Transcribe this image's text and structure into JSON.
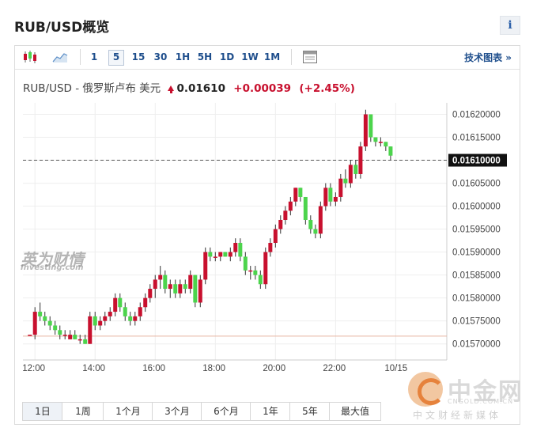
{
  "page": {
    "title": "RUB/USD概览",
    "info_label": "i"
  },
  "toolbar": {
    "intervals": [
      "1",
      "5",
      "15",
      "30",
      "1H",
      "5H",
      "1D",
      "1W",
      "1M"
    ],
    "active_interval": "5",
    "tech_link": "技术图表 »"
  },
  "quote": {
    "pair": "RUB/USD - 俄罗斯卢布 美元",
    "price": "0.01610",
    "change": "+0.00039",
    "change_pct": "(+2.45%)"
  },
  "watermark": {
    "main": "英为财情",
    "sub": "Investing.com"
  },
  "ranges": {
    "items": [
      "1日",
      "1周",
      "1个月",
      "3个月",
      "6个月",
      "1年",
      "5年",
      "最大值"
    ],
    "active": "1日"
  },
  "colors": {
    "up": "#c8102e",
    "down": "#4cd44c",
    "last_line": "#555555",
    "ref_line": "#e8b4a0",
    "grid": "#eeeeee"
  },
  "brand": {
    "name": "中金网",
    "url": "CNGOLD.COM.CN",
    "slogan": "中文财经新媒体"
  },
  "chart_data": {
    "type": "candlestick",
    "x_labels": [
      "12:00",
      "14:00",
      "16:00",
      "18:00",
      "20:00",
      "22:00",
      "10/15"
    ],
    "y_ticks": [
      "0.01570000",
      "0.01575000",
      "0.01580000",
      "0.01585000",
      "0.01590000",
      "0.01595000",
      "0.01600000",
      "0.01605000",
      "0.01610000",
      "0.01615000",
      "0.01620000"
    ],
    "ylim": [
      0.015665,
      0.016225
    ],
    "xlim": [
      11.6,
      25.7
    ],
    "last_price": 0.0161,
    "last_label": "0.01610000",
    "ref_price": 0.015717,
    "grid": true,
    "candles": [
      {
        "t": 11.83,
        "o": 0.01572,
        "h": 0.01572,
        "l": 0.01572,
        "c": 0.01572
      },
      {
        "t": 12.0,
        "o": 0.01572,
        "h": 0.01578,
        "l": 0.01571,
        "c": 0.01577
      },
      {
        "t": 12.17,
        "o": 0.01577,
        "h": 0.01579,
        "l": 0.01575,
        "c": 0.01576
      },
      {
        "t": 12.33,
        "o": 0.01576,
        "h": 0.01577,
        "l": 0.01574,
        "c": 0.01575
      },
      {
        "t": 12.5,
        "o": 0.01575,
        "h": 0.01576,
        "l": 0.01573,
        "c": 0.01574
      },
      {
        "t": 12.67,
        "o": 0.01574,
        "h": 0.01575,
        "l": 0.01572,
        "c": 0.01573
      },
      {
        "t": 12.83,
        "o": 0.01573,
        "h": 0.01574,
        "l": 0.01571,
        "c": 0.01572
      },
      {
        "t": 13.0,
        "o": 0.01572,
        "h": 0.01573,
        "l": 0.01571,
        "c": 0.01572
      },
      {
        "t": 13.17,
        "o": 0.01571,
        "h": 0.01573,
        "l": 0.01571,
        "c": 0.01572
      },
      {
        "t": 13.33,
        "o": 0.01572,
        "h": 0.01573,
        "l": 0.01571,
        "c": 0.01571
      },
      {
        "t": 13.5,
        "o": 0.01571,
        "h": 0.01572,
        "l": 0.0157,
        "c": 0.01571
      },
      {
        "t": 13.67,
        "o": 0.01571,
        "h": 0.01572,
        "l": 0.0157,
        "c": 0.0157
      },
      {
        "t": 13.83,
        "o": 0.0157,
        "h": 0.01577,
        "l": 0.0157,
        "c": 0.01576
      },
      {
        "t": 14.0,
        "o": 0.01576,
        "h": 0.01577,
        "l": 0.01573,
        "c": 0.01574
      },
      {
        "t": 14.17,
        "o": 0.01574,
        "h": 0.01576,
        "l": 0.01573,
        "c": 0.01575
      },
      {
        "t": 14.33,
        "o": 0.01575,
        "h": 0.01577,
        "l": 0.01574,
        "c": 0.01576
      },
      {
        "t": 14.5,
        "o": 0.01576,
        "h": 0.01578,
        "l": 0.01575,
        "c": 0.01577
      },
      {
        "t": 14.67,
        "o": 0.01577,
        "h": 0.01581,
        "l": 0.01576,
        "c": 0.0158
      },
      {
        "t": 14.83,
        "o": 0.0158,
        "h": 0.01581,
        "l": 0.01577,
        "c": 0.01578
      },
      {
        "t": 15.0,
        "o": 0.01578,
        "h": 0.01579,
        "l": 0.01575,
        "c": 0.01576
      },
      {
        "t": 15.17,
        "o": 0.01576,
        "h": 0.01577,
        "l": 0.01574,
        "c": 0.01575
      },
      {
        "t": 15.33,
        "o": 0.01575,
        "h": 0.01577,
        "l": 0.01574,
        "c": 0.01576
      },
      {
        "t": 15.5,
        "o": 0.01576,
        "h": 0.01579,
        "l": 0.01575,
        "c": 0.01578
      },
      {
        "t": 15.67,
        "o": 0.01578,
        "h": 0.01581,
        "l": 0.01577,
        "c": 0.0158
      },
      {
        "t": 15.83,
        "o": 0.0158,
        "h": 0.01583,
        "l": 0.01579,
        "c": 0.01582
      },
      {
        "t": 16.0,
        "o": 0.01582,
        "h": 0.01585,
        "l": 0.0158,
        "c": 0.01584
      },
      {
        "t": 16.17,
        "o": 0.01584,
        "h": 0.01587,
        "l": 0.01582,
        "c": 0.01585
      },
      {
        "t": 16.33,
        "o": 0.01585,
        "h": 0.01586,
        "l": 0.01581,
        "c": 0.01582
      },
      {
        "t": 16.5,
        "o": 0.01582,
        "h": 0.01584,
        "l": 0.0158,
        "c": 0.01583
      },
      {
        "t": 16.67,
        "o": 0.01583,
        "h": 0.01584,
        "l": 0.0158,
        "c": 0.01581
      },
      {
        "t": 16.83,
        "o": 0.01581,
        "h": 0.01584,
        "l": 0.0158,
        "c": 0.01583
      },
      {
        "t": 17.0,
        "o": 0.01583,
        "h": 0.01584,
        "l": 0.01581,
        "c": 0.01582
      },
      {
        "t": 17.17,
        "o": 0.01582,
        "h": 0.01586,
        "l": 0.01581,
        "c": 0.01585
      },
      {
        "t": 17.33,
        "o": 0.01585,
        "h": 0.01585,
        "l": 0.01578,
        "c": 0.01579
      },
      {
        "t": 17.5,
        "o": 0.01579,
        "h": 0.01585,
        "l": 0.01578,
        "c": 0.01584
      },
      {
        "t": 17.67,
        "o": 0.01584,
        "h": 0.01591,
        "l": 0.01583,
        "c": 0.0159
      },
      {
        "t": 17.83,
        "o": 0.0159,
        "h": 0.01591,
        "l": 0.01588,
        "c": 0.01589
      },
      {
        "t": 18.0,
        "o": 0.01589,
        "h": 0.0159,
        "l": 0.01588,
        "c": 0.01589
      },
      {
        "t": 18.17,
        "o": 0.01589,
        "h": 0.0159,
        "l": 0.01588,
        "c": 0.0159
      },
      {
        "t": 18.33,
        "o": 0.0159,
        "h": 0.0159,
        "l": 0.01589,
        "c": 0.01589
      },
      {
        "t": 18.5,
        "o": 0.01589,
        "h": 0.01591,
        "l": 0.01588,
        "c": 0.0159
      },
      {
        "t": 18.67,
        "o": 0.0159,
        "h": 0.01593,
        "l": 0.01589,
        "c": 0.01592
      },
      {
        "t": 18.83,
        "o": 0.01592,
        "h": 0.01593,
        "l": 0.01588,
        "c": 0.01589
      },
      {
        "t": 19.0,
        "o": 0.01589,
        "h": 0.0159,
        "l": 0.01585,
        "c": 0.01586
      },
      {
        "t": 19.17,
        "o": 0.01586,
        "h": 0.01587,
        "l": 0.01584,
        "c": 0.01586
      },
      {
        "t": 19.33,
        "o": 0.01586,
        "h": 0.01587,
        "l": 0.01584,
        "c": 0.01585
      },
      {
        "t": 19.5,
        "o": 0.01585,
        "h": 0.01586,
        "l": 0.01582,
        "c": 0.01583
      },
      {
        "t": 19.67,
        "o": 0.01583,
        "h": 0.01591,
        "l": 0.01582,
        "c": 0.0159
      },
      {
        "t": 19.83,
        "o": 0.0159,
        "h": 0.01593,
        "l": 0.01589,
        "c": 0.01592
      },
      {
        "t": 20.0,
        "o": 0.01592,
        "h": 0.01596,
        "l": 0.01591,
        "c": 0.01595
      },
      {
        "t": 20.17,
        "o": 0.01595,
        "h": 0.01598,
        "l": 0.01594,
        "c": 0.01597
      },
      {
        "t": 20.33,
        "o": 0.01597,
        "h": 0.016,
        "l": 0.01596,
        "c": 0.01599
      },
      {
        "t": 20.5,
        "o": 0.01599,
        "h": 0.01602,
        "l": 0.01598,
        "c": 0.01601
      },
      {
        "t": 20.67,
        "o": 0.01601,
        "h": 0.01604,
        "l": 0.016,
        "c": 0.01604
      },
      {
        "t": 20.83,
        "o": 0.01604,
        "h": 0.01604,
        "l": 0.01601,
        "c": 0.01602
      },
      {
        "t": 21.0,
        "o": 0.01602,
        "h": 0.01602,
        "l": 0.01596,
        "c": 0.01597
      },
      {
        "t": 21.17,
        "o": 0.01597,
        "h": 0.01598,
        "l": 0.01594,
        "c": 0.01595
      },
      {
        "t": 21.33,
        "o": 0.01595,
        "h": 0.01596,
        "l": 0.01593,
        "c": 0.01594
      },
      {
        "t": 21.5,
        "o": 0.01594,
        "h": 0.01601,
        "l": 0.01593,
        "c": 0.016
      },
      {
        "t": 21.67,
        "o": 0.016,
        "h": 0.01605,
        "l": 0.01599,
        "c": 0.01604
      },
      {
        "t": 21.83,
        "o": 0.01604,
        "h": 0.01605,
        "l": 0.016,
        "c": 0.01601
      },
      {
        "t": 22.0,
        "o": 0.01601,
        "h": 0.01603,
        "l": 0.016,
        "c": 0.01602
      },
      {
        "t": 22.17,
        "o": 0.01602,
        "h": 0.01607,
        "l": 0.01601,
        "c": 0.01606
      },
      {
        "t": 22.33,
        "o": 0.01606,
        "h": 0.01608,
        "l": 0.01604,
        "c": 0.01605
      },
      {
        "t": 22.5,
        "o": 0.01605,
        "h": 0.0161,
        "l": 0.01604,
        "c": 0.01609
      },
      {
        "t": 22.67,
        "o": 0.01609,
        "h": 0.0161,
        "l": 0.01606,
        "c": 0.01607
      },
      {
        "t": 22.83,
        "o": 0.01607,
        "h": 0.01614,
        "l": 0.01606,
        "c": 0.01613
      },
      {
        "t": 23.0,
        "o": 0.01613,
        "h": 0.01621,
        "l": 0.01612,
        "c": 0.0162
      },
      {
        "t": 23.17,
        "o": 0.0162,
        "h": 0.0162,
        "l": 0.01614,
        "c": 0.01615
      },
      {
        "t": 23.33,
        "o": 0.01615,
        "h": 0.01615,
        "l": 0.01613,
        "c": 0.01614
      },
      {
        "t": 23.5,
        "o": 0.01614,
        "h": 0.01615,
        "l": 0.01613,
        "c": 0.01614
      },
      {
        "t": 23.67,
        "o": 0.01614,
        "h": 0.01614,
        "l": 0.01612,
        "c": 0.01613
      },
      {
        "t": 23.83,
        "o": 0.01613,
        "h": 0.01613,
        "l": 0.0161,
        "c": 0.01611
      }
    ]
  }
}
